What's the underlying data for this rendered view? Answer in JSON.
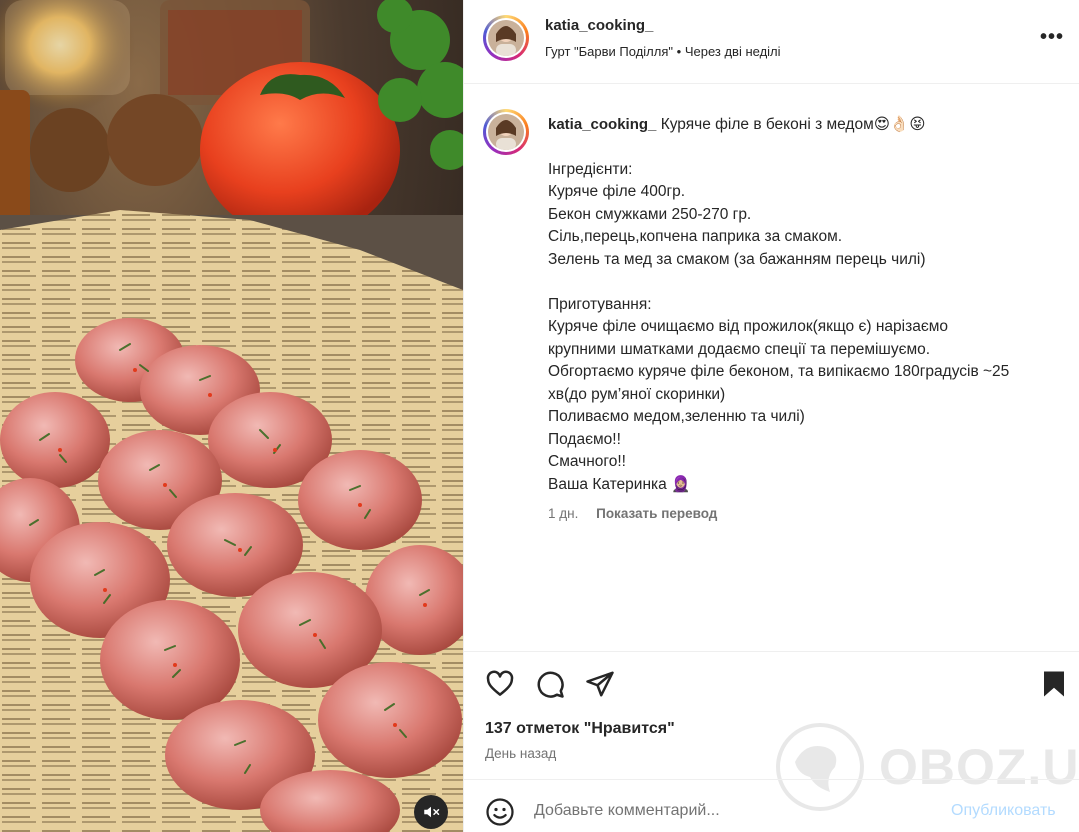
{
  "post": {
    "username": "katia_cooking_",
    "location": "Гурт \"Барви Поділля\"",
    "audio_separator": "•",
    "audio": "Через дві неділі",
    "more": "•••"
  },
  "caption": {
    "username": "katia_cooking_",
    "title": "Куряче філе в беконі з медом😍👌🏻😝",
    "lines": [
      "Інгредієнти:",
      "Куряче філе 400гр.",
      "Бекон смужками 250-270 гр.",
      "Сіль,перець,копчена паприка за смаком.",
      "Зелень та мед за смаком (за бажанням перець чилі)",
      "",
      "Приготування:",
      "Куряче філе очищаємо від прожилок(якщо є) нарізаємо",
      "крупними шматками додаємо спеції та перемішуємо.",
      "Обгортаємо куряче філе беконом, та випікаємо 180градусів ~25",
      "хв(до рум’яної скоринки)",
      "Поливаємо медом,зеленню та чилі)",
      "Подаємо!!",
      "Смачного!!",
      "Ваша Катеринка 🧕🏼"
    ],
    "age": "1 дн.",
    "translate": "Показать перевод"
  },
  "stats": {
    "likes": "137 отметок \"Нравится\"",
    "time": "День назад"
  },
  "comment": {
    "placeholder": "Добавьте комментарий...",
    "post_label": "Опубликовать"
  },
  "watermark": {
    "text": "OBOZ.UA"
  },
  "colors": {
    "link_disabled": "#b3dbff",
    "muted": "#737373",
    "text": "#262626"
  }
}
